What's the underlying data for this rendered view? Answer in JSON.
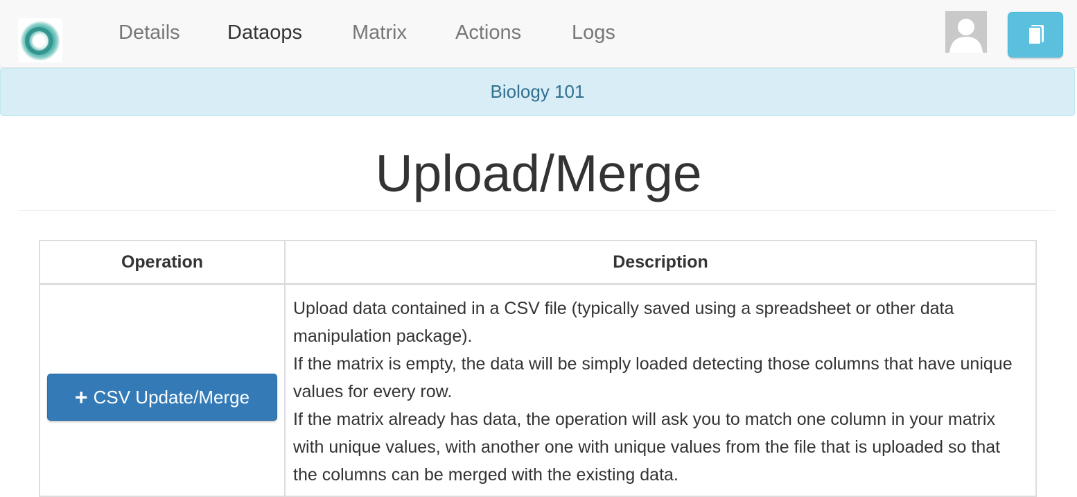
{
  "nav": {
    "items": [
      {
        "label": "Details"
      },
      {
        "label": "Dataops"
      },
      {
        "label": "Matrix"
      },
      {
        "label": "Actions"
      },
      {
        "label": "Logs"
      }
    ],
    "active": "Dataops",
    "logo_icon": "app-logo-icon",
    "avatar_icon": "user-avatar-icon",
    "doc_icon": "book-icon"
  },
  "course": {
    "name": "Biology 101"
  },
  "page": {
    "title": "Upload/Merge"
  },
  "table": {
    "headers": {
      "operation": "Operation",
      "description": "Description"
    },
    "rows": [
      {
        "button": {
          "icon": "plus-icon",
          "label": "CSV Update/Merge"
        },
        "description": [
          "Upload data contained in a CSV file (typically saved using a spreadsheet or other data manipulation package).",
          "If the matrix is empty, the data will be simply loaded detecting those columns that have unique values for every row.",
          "If the matrix already has data, the operation will ask you to match one column in your matrix with unique values, with another one with unique values from the file that is uploaded so that the columns can be merged with the existing data."
        ]
      }
    ]
  },
  "colors": {
    "navbar_bg": "#f8f8f8",
    "info_bg": "#d9edf7",
    "info_text": "#31708f",
    "primary": "#337ab7",
    "info_button": "#5bc0de"
  }
}
